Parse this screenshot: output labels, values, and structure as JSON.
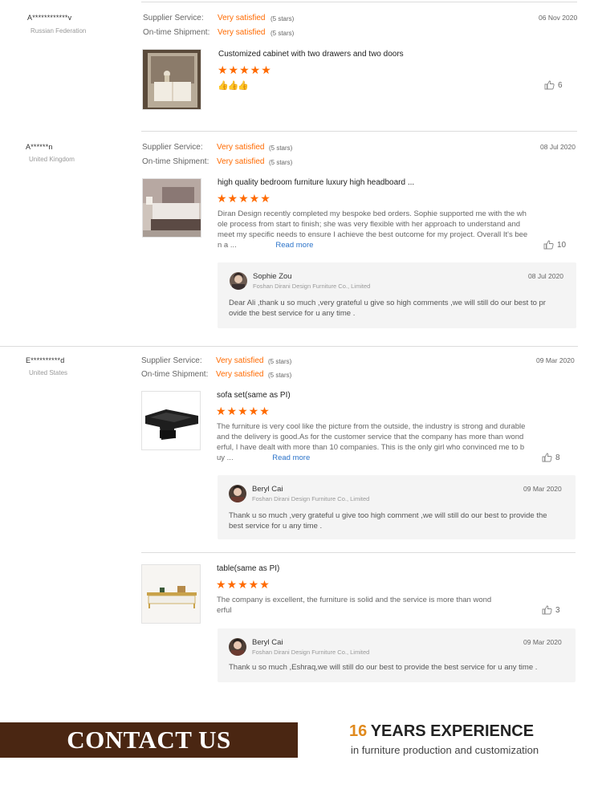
{
  "labels": {
    "supplier_service": "Supplier Service:",
    "ontime_shipment": "On-time Shipment:",
    "read_more": "Read more"
  },
  "reviews": [
    {
      "user": "A************v",
      "country": "Russian Federation",
      "supplier_rating": "Very satisfied",
      "supplier_stars": "(5 stars)",
      "shipment_rating": "Very satisfied",
      "shipment_stars": "(5 stars)",
      "date": "06 Nov 2020",
      "items": [
        {
          "title": "Customized cabinet with two drawers and two doors",
          "stars": "★★★★★",
          "text": "",
          "likes": "6"
        }
      ]
    },
    {
      "user": "A******n",
      "country": "United Kingdom",
      "supplier_rating": "Very satisfied",
      "supplier_stars": "(5 stars)",
      "shipment_rating": "Very satisfied",
      "shipment_stars": "(5 stars)",
      "date": "08 Jul 2020",
      "items": [
        {
          "title": "high quality bedroom furniture luxury high headboard ...",
          "stars": "★★★★★",
          "text_lines": [
            "Diran Design recently completed my bespoke bed orders. Sophie supported me with the wh",
            "ole process from start to finish; she was very flexible with her approach to understand and",
            "meet my specific needs to ensure I achieve the best outcome for my project. Overall It's bee",
            "n a ..."
          ],
          "likes": "10",
          "reply": {
            "name": "Sophie Zou",
            "company": "Foshan Dirani Design Furniture Co., Limited",
            "date": "08 Jul 2020",
            "text_lines": [
              "Dear Ali ,thank u so much ,very grateful u give so high comments ,we will still do our best to pr",
              "ovide the best service for u any time ."
            ]
          }
        }
      ]
    },
    {
      "user": "E**********d",
      "country": "United States",
      "supplier_rating": "Very satisfied",
      "supplier_stars": "(5 stars)",
      "shipment_rating": "Very satisfied",
      "shipment_stars": "(5 stars)",
      "date": "09 Mar 2020",
      "items": [
        {
          "title": "sofa set(same as PI)",
          "stars": "★★★★★",
          "text_lines": [
            "The furniture is very cool like the picture from the outside, the industry is strong and durable",
            "and the delivery is good.As for the customer service that the company has more than wond",
            "erful, I have dealt with more than 10 companies. This is the only girl who convinced me to b",
            "uy ..."
          ],
          "likes": "8",
          "reply": {
            "name": "Beryl Cai",
            "company": "Foshan Dirani Design Furniture Co., Limited",
            "date": "09 Mar 2020",
            "text_lines": [
              "Thank u so much ,very grateful u give too high comment ,we will still do our best to provide the",
              "best service for u any time ."
            ]
          }
        },
        {
          "title": "table(same as PI)",
          "stars": "★★★★★",
          "text_lines": [
            "The company is excellent, the furniture is solid and the service is more than wond",
            "erful"
          ],
          "likes": "3",
          "reply": {
            "name": "Beryl Cai",
            "company": "Foshan Dirani Design Furniture Co., Limited",
            "date": "09 Mar 2020",
            "text_lines": [
              "Thank u so much ,Eshraq,we will still do our best to provide the best service for u any time ."
            ]
          }
        }
      ]
    }
  ],
  "footer": {
    "contact": "CONTACT US",
    "years_number": "16",
    "years_text": "YEARS EXPERIENCE",
    "subline": "in furniture production and customization"
  },
  "colors": {
    "accent": "#ff6a00",
    "link": "#2b73c9",
    "banner": "#4a2612",
    "years": "#e08a1e"
  },
  "icons": {
    "like": "thumbs-up-icon",
    "star": "star-icon",
    "emoji": "thumbs-up-emoji-icon"
  }
}
